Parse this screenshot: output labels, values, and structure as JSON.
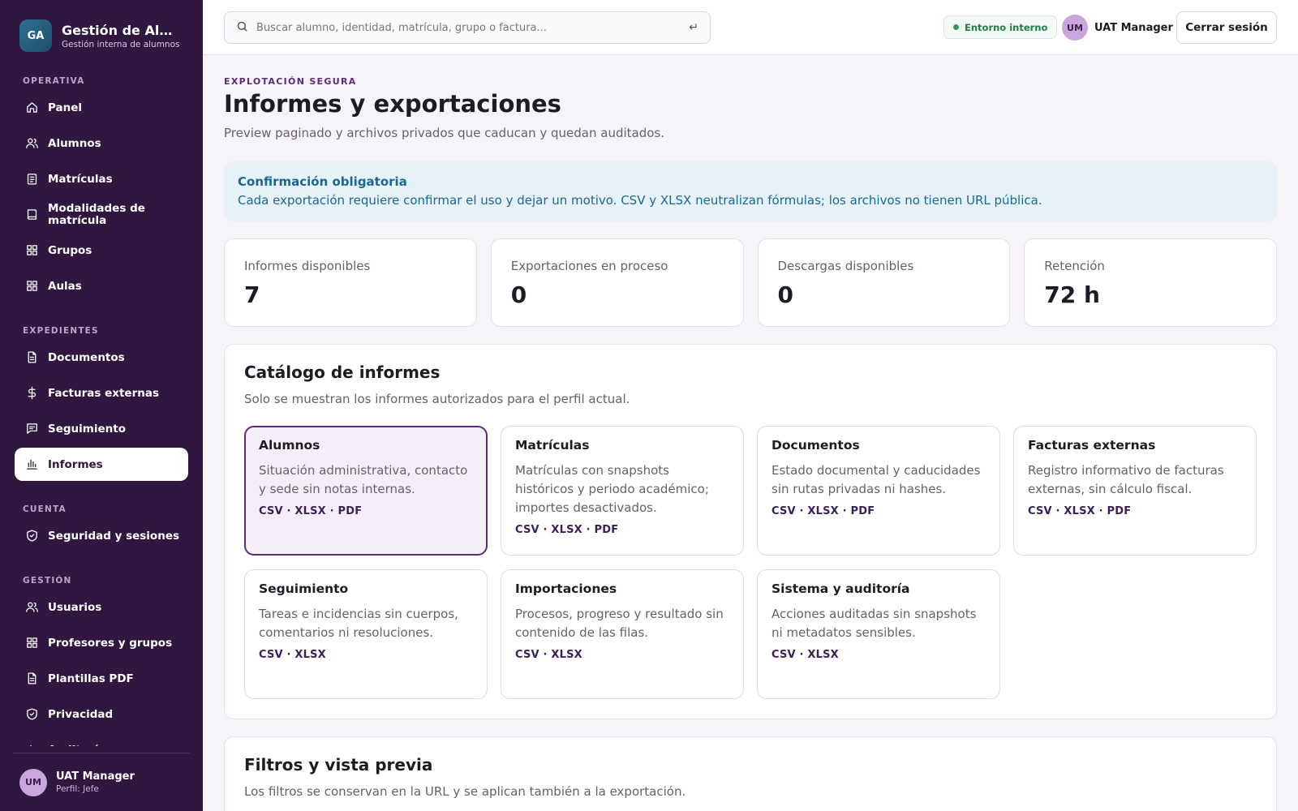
{
  "brand": {
    "logo": "GA",
    "title": "Gestión de Alumnos",
    "subtitle": "Gestión interna de alumnos"
  },
  "sidebar": {
    "sections": [
      {
        "label": "OPERATIVA",
        "items": [
          {
            "label": "Panel",
            "icon": "home-icon"
          },
          {
            "label": "Alumnos",
            "icon": "users-icon"
          },
          {
            "label": "Matrículas",
            "icon": "clipboard-icon"
          },
          {
            "label": "Modalidades de matrícula",
            "icon": "book-icon"
          },
          {
            "label": "Grupos",
            "icon": "grid-icon"
          },
          {
            "label": "Aulas",
            "icon": "grid-icon"
          }
        ]
      },
      {
        "label": "EXPEDIENTES",
        "items": [
          {
            "label": "Documentos",
            "icon": "document-icon"
          },
          {
            "label": "Facturas externas",
            "icon": "dollar-icon"
          },
          {
            "label": "Seguimiento",
            "icon": "message-icon"
          },
          {
            "label": "Informes",
            "icon": "bar-chart-icon",
            "active": true
          }
        ]
      },
      {
        "label": "CUENTA",
        "items": [
          {
            "label": "Seguridad y sesiones",
            "icon": "shield-icon"
          }
        ]
      },
      {
        "label": "GESTIÓN",
        "items": [
          {
            "label": "Usuarios",
            "icon": "users-icon"
          },
          {
            "label": "Profesores y grupos",
            "icon": "grid-icon"
          },
          {
            "label": "Plantillas PDF",
            "icon": "document-icon"
          },
          {
            "label": "Privacidad",
            "icon": "shield-icon"
          },
          {
            "label": "Auditoría",
            "icon": "activity-icon"
          }
        ]
      }
    ],
    "footer": {
      "initials": "UM",
      "name": "UAT Manager",
      "role": "Perfil: Jefe"
    }
  },
  "topbar": {
    "search_placeholder": "Buscar alumno, identidad, matrícula, grupo o factura...",
    "enter_symbol": "↵",
    "env_badge": "Entorno interno",
    "user_initials": "UM",
    "user_name": "UAT Manager",
    "logout_label": "Cerrar sesión"
  },
  "page": {
    "eyebrow": "EXPLOTACIÓN SEGURA",
    "title": "Informes y exportaciones",
    "subtitle": "Preview paginado y archivos privados que caducan y quedan auditados."
  },
  "alert": {
    "title": "Confirmación obligatoria",
    "text": "Cada exportación requiere confirmar el uso y dejar un motivo. CSV y XLSX neutralizan fórmulas; los archivos no tienen URL pública."
  },
  "stats": [
    {
      "label": "Informes disponibles",
      "value": "7"
    },
    {
      "label": "Exportaciones en proceso",
      "value": "0"
    },
    {
      "label": "Descargas disponibles",
      "value": "0"
    },
    {
      "label": "Retención",
      "value": "72 h"
    }
  ],
  "catalog": {
    "title": "Catálogo de informes",
    "subtitle": "Solo se muestran los informes autorizados para el perfil actual.",
    "cards": [
      {
        "title": "Alumnos",
        "desc": "Situación administrativa, contacto y sede sin notas internas.",
        "formats": "CSV · XLSX · PDF",
        "selected": true
      },
      {
        "title": "Matrículas",
        "desc": "Matrículas con snapshots históricos y periodo académico; importes desactivados.",
        "formats": "CSV · XLSX · PDF"
      },
      {
        "title": "Documentos",
        "desc": "Estado documental y caducidades sin rutas privadas ni hashes.",
        "formats": "CSV · XLSX · PDF"
      },
      {
        "title": "Facturas externas",
        "desc": "Registro informativo de facturas externas, sin cálculo fiscal.",
        "formats": "CSV · XLSX · PDF"
      },
      {
        "title": "Seguimiento",
        "desc": "Tareas e incidencias sin cuerpos, comentarios ni resoluciones.",
        "formats": "CSV · XLSX"
      },
      {
        "title": "Importaciones",
        "desc": "Procesos, progreso y resultado sin contenido de las filas.",
        "formats": "CSV · XLSX"
      },
      {
        "title": "Sistema y auditoría",
        "desc": "Acciones auditadas sin snapshots ni metadatos sensibles.",
        "formats": "CSV · XLSX"
      }
    ]
  },
  "filters": {
    "title": "Filtros y vista previa",
    "subtitle": "Los filtros se conservan en la URL y se aplican también a la exportación."
  }
}
